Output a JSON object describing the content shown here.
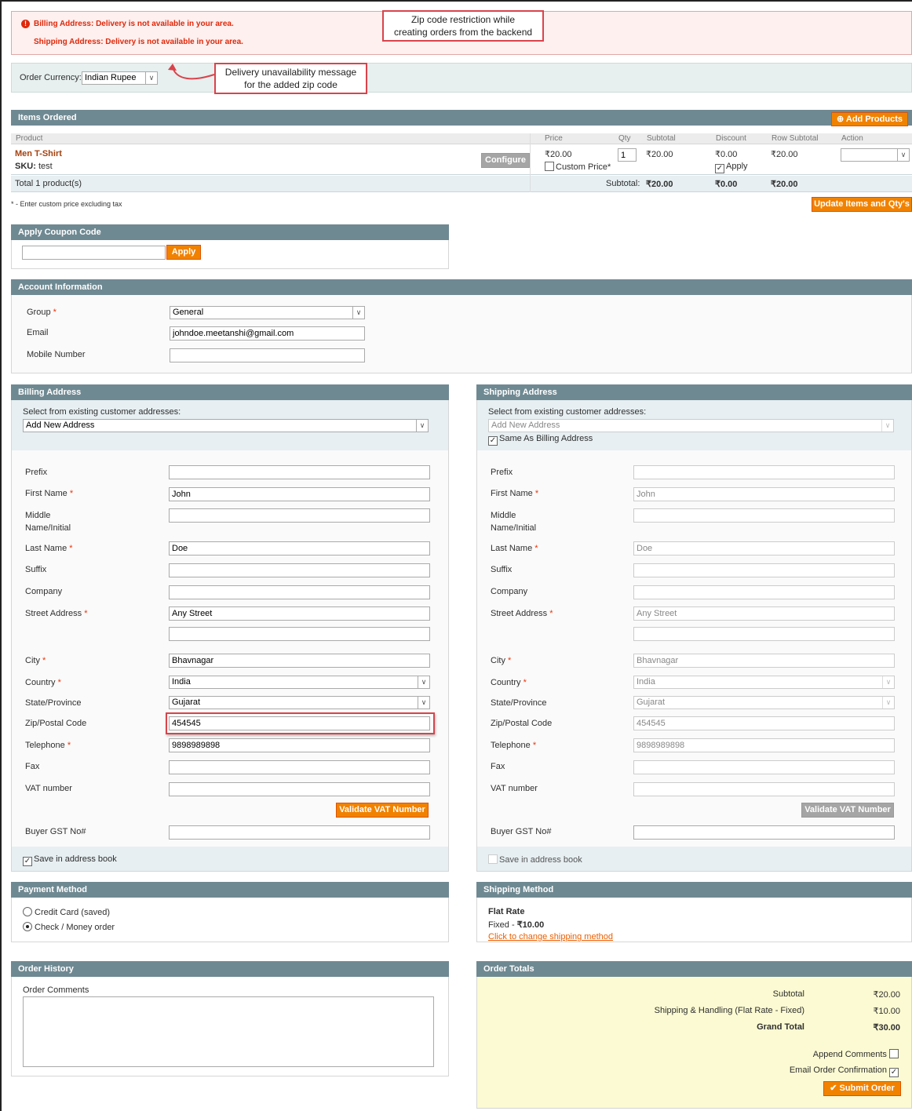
{
  "errors": {
    "billing": "Billing Address: Delivery is not available in your area.",
    "shipping": "Shipping Address: Delivery is not available in your area."
  },
  "callouts": {
    "zip_restriction": [
      "Zip code restriction while",
      "creating orders from the backend"
    ],
    "delivery_msg": [
      "Delivery unavailability message",
      "for the added zip code"
    ]
  },
  "currency": {
    "label": "Order Currency:",
    "value": "Indian Rupee"
  },
  "items": {
    "title": "Items Ordered",
    "add_products": "Add Products",
    "cols": {
      "product": "Product",
      "price": "Price",
      "qty": "Qty",
      "subtotal": "Subtotal",
      "discount": "Discount",
      "row_subtotal": "Row Subtotal",
      "action": "Action"
    },
    "row": {
      "name": "Men T-Shirt",
      "sku_label": "SKU:",
      "sku": "test",
      "configure": "Configure",
      "price": "₹20.00",
      "custom_price": "Custom Price*",
      "qty": "1",
      "subtotal": "₹20.00",
      "discount": "₹0.00",
      "apply": "Apply",
      "row_subtotal": "₹20.00"
    },
    "total": {
      "label": "Total 1 product(s)",
      "subtotal_label": "Subtotal:",
      "subtotal": "₹20.00",
      "discount": "₹0.00",
      "row_subtotal": "₹20.00"
    },
    "note": "* - Enter custom price excluding tax",
    "update": "Update Items and Qty's"
  },
  "coupon": {
    "title": "Apply Coupon Code",
    "apply": "Apply"
  },
  "account": {
    "title": "Account Information",
    "group_label": "Group",
    "group": "General",
    "email_label": "Email",
    "email": "johndoe.meetanshi@gmail.com",
    "mobile_label": "Mobile Number"
  },
  "billing": {
    "title": "Billing Address",
    "select_label": "Select from existing customer addresses:",
    "select_value": "Add New Address",
    "prefix": "Prefix",
    "first_name": "First Name",
    "first_value": "John",
    "middle1": "Middle",
    "middle2": "Name/Initial",
    "last_name": "Last Name",
    "last_value": "Doe",
    "suffix": "Suffix",
    "company": "Company",
    "street": "Street Address",
    "street_value": "Any Street",
    "city": "City",
    "city_value": "Bhavnagar",
    "country": "Country",
    "country_value": "India",
    "state": "State/Province",
    "state_value": "Gujarat",
    "zip": "Zip/Postal Code",
    "zip_value": "454545",
    "telephone": "Telephone",
    "telephone_value": "9898989898",
    "fax": "Fax",
    "vat": "VAT number",
    "validate": "Validate VAT Number",
    "gst": "Buyer GST No#",
    "save": "Save in address book"
  },
  "shipping": {
    "title": "Shipping Address",
    "same_as": "Same As Billing Address"
  },
  "payment": {
    "title": "Payment Method",
    "cc": "Credit Card (saved)",
    "check": "Check / Money order"
  },
  "shipmethod": {
    "title": "Shipping Method",
    "name": "Flat Rate",
    "fixed": "Fixed - ",
    "price": "₹10.00",
    "change": "Click to change shipping method"
  },
  "history": {
    "title": "Order History",
    "comments": "Order Comments"
  },
  "totals": {
    "title": "Order Totals",
    "subtotal_label": "Subtotal",
    "subtotal": "₹20.00",
    "shipping_label": "Shipping & Handling (Flat Rate - Fixed)",
    "shipping": "₹10.00",
    "grand_label": "Grand Total",
    "grand": "₹30.00",
    "append": "Append Comments",
    "email": "Email Order Confirmation",
    "submit": "Submit Order"
  },
  "colors": {
    "header": "#6f8992",
    "orange": "#f18200",
    "error": "#df280a",
    "annotation": "#d9434b",
    "totals_bg": "#fbfad2"
  }
}
